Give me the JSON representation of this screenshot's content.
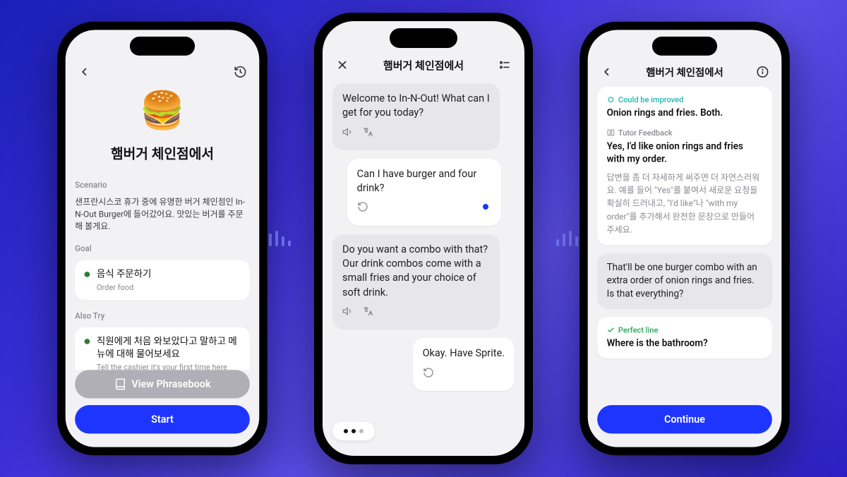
{
  "phone1": {
    "title": "햄버거 체인점에서",
    "emoji": "🍔",
    "scenario_label": "Scenario",
    "scenario_text": "샌프란시스코 휴가 중에 유명한 버거 체인점인 In-N-Out Burger에 들어갔어요. 맛있는 버거를 주문해 볼게요.",
    "goal_label": "Goal",
    "goal": {
      "title": "음식 주문하기",
      "sub": "Order food"
    },
    "also_try_label": "Also Try",
    "also_try": {
      "title": "직원에게 처음 와보았다고 말하고 메뉴에 대해 물어보세요",
      "sub": "Tell the cashier it's your first time here and ask what's on the menu"
    },
    "phrasebook_btn": "View Phrasebook",
    "start_btn": "Start"
  },
  "phone2": {
    "title": "햄버거 체인점에서",
    "bot1": "Welcome to In-N-Out! What can I get for you today?",
    "me1": "Can I have burger and four drink?",
    "bot2": "Do you want a combo with that? Our drink combos come with a small fries and your choice of soft drink.",
    "me2": "Okay. Have Sprite."
  },
  "phone3": {
    "title": "햄버거 체인점에서",
    "improve_tag": "Could be improved",
    "improve_text": "Onion rings and fries. Both.",
    "tutor_tag": "Tutor Feedback",
    "tutor_text": "Yes, I'd like onion rings and fries with my order.",
    "tutor_explain": "답변을 좀 더 자세하게 써주면 더 자연스러워요. 예를 들어 \"Yes\"를 붙여서 새로운 요청을 확실히 드러내고, \"I'd like\"나 \"with my order\"를 추가해서 완전한 문장으로 만들어 주세요.",
    "bot_reply": "That'll be one burger combo with an extra order of onion rings and fries. Is that everything?",
    "perfect_tag": "Perfect line",
    "perfect_text": "Where is the bathroom?",
    "continue_btn": "Continue"
  }
}
